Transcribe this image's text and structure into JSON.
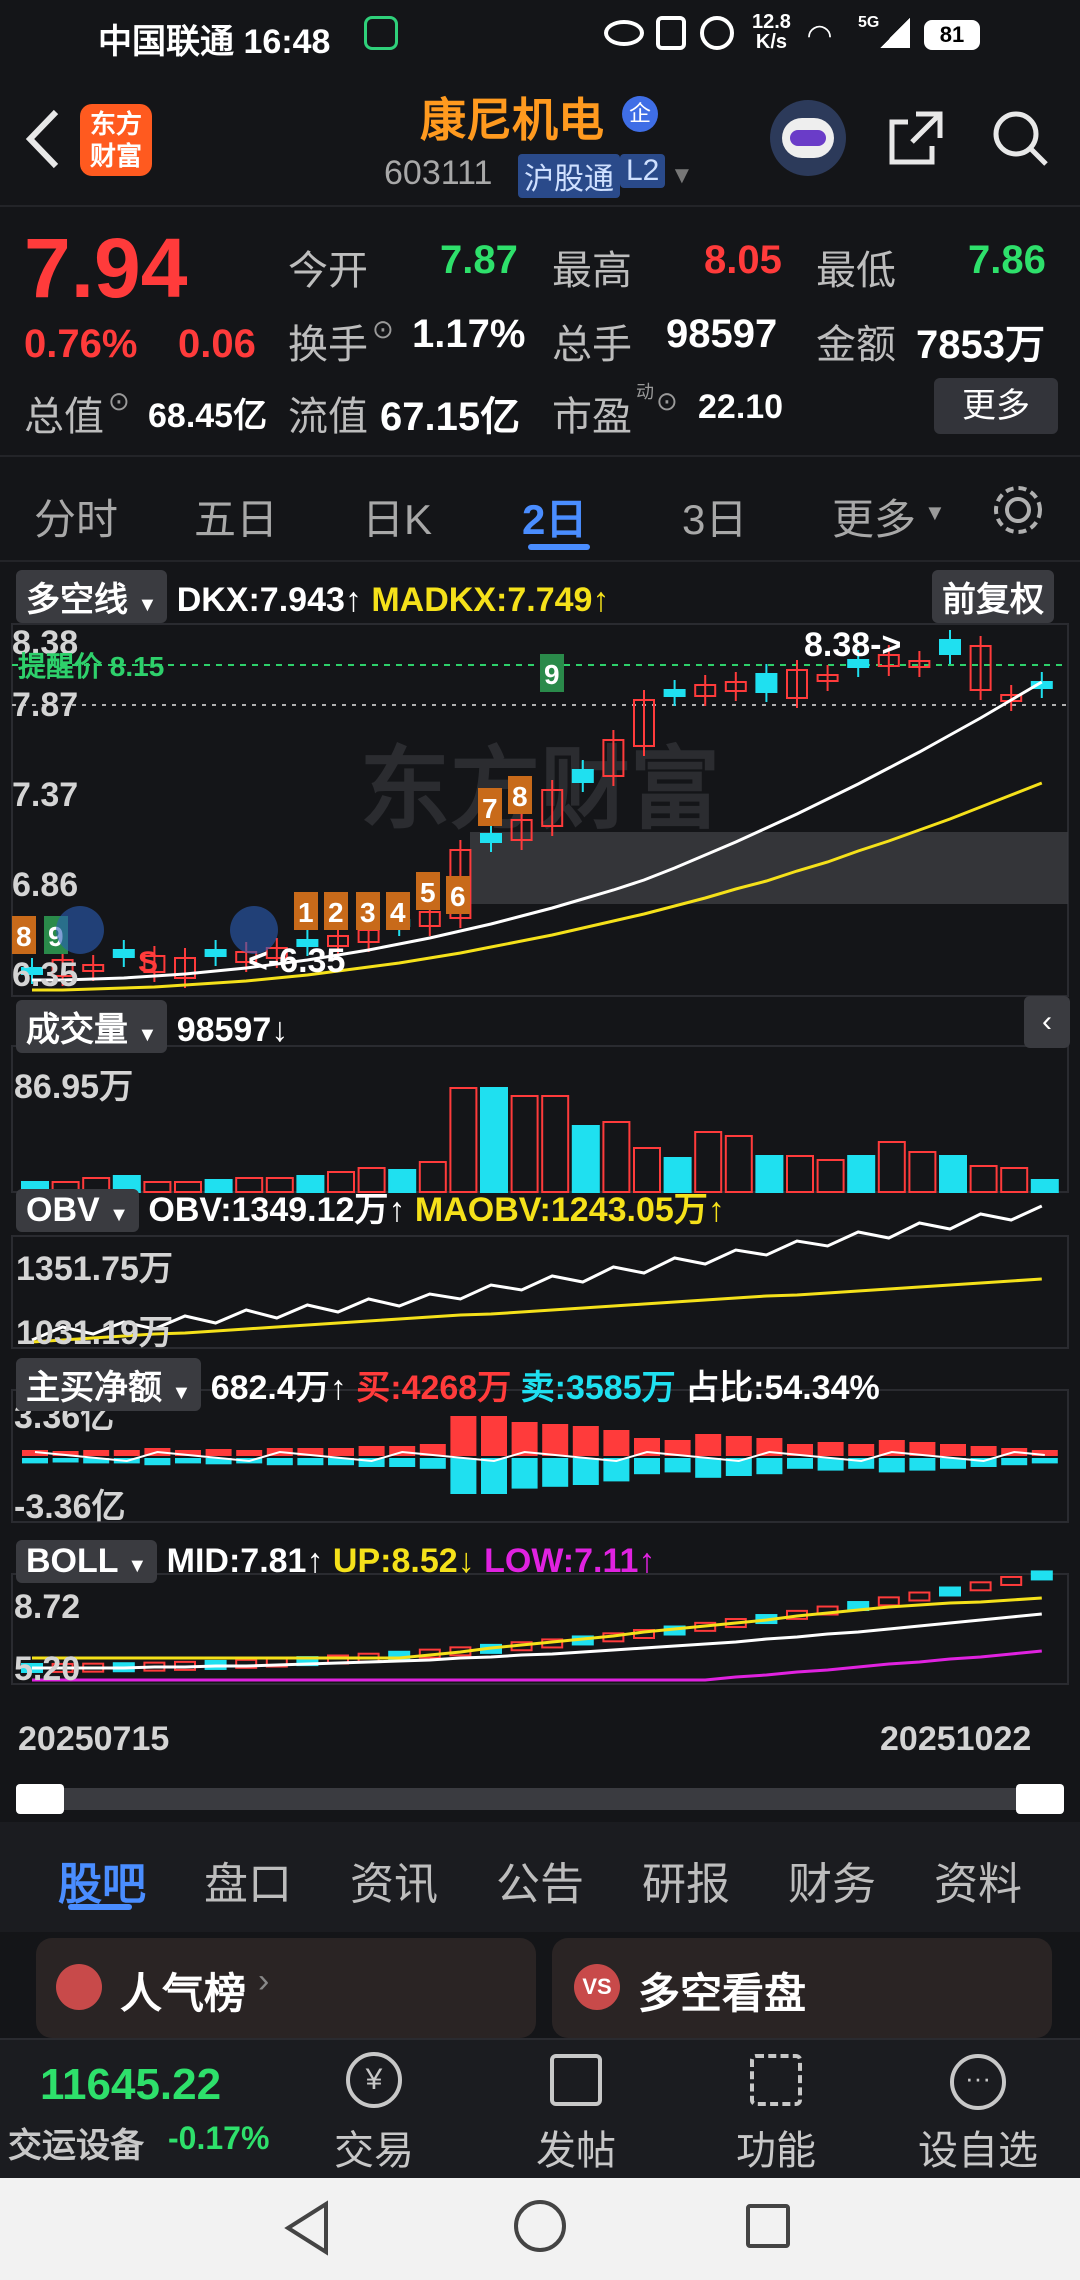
{
  "status_bar": {
    "carrier_time": "中国联通 16:48",
    "net_speed_top": "12.8",
    "net_speed_bottom": "K/s",
    "signal_5g": "5G",
    "battery": "81"
  },
  "header": {
    "logo_line1": "东方",
    "logo_line2": "财富",
    "stock_name": "康尼机电",
    "badge_qi": "企",
    "stock_code": "603111",
    "market_tag": "沪股通",
    "level_tag": "L2"
  },
  "quote": {
    "price": "7.94",
    "change_pct": "0.76%",
    "change_amt": "0.06",
    "open_label": "今开",
    "open": "7.87",
    "high_label": "最高",
    "high": "8.05",
    "low_label": "最低",
    "low": "7.86",
    "turnover_label": "换手",
    "turnover": "1.17%",
    "volume_label": "总手",
    "volume": "98597",
    "amount_label": "金额",
    "amount": "7853万",
    "mcap_label": "总值",
    "mcap": "68.45亿",
    "float_label": "流值",
    "float": "67.15亿",
    "pe_label": "市盈",
    "pe_sup": "动",
    "pe": "22.10",
    "more_button": "更多"
  },
  "chart_tabs": [
    "分时",
    "五日",
    "日K",
    "2日",
    "3日",
    "更多"
  ],
  "active_tab": "2日",
  "main_chart": {
    "indicator": "多空线",
    "dkx": "DKX:7.943↑",
    "madkx": "MADKX:7.749↑",
    "adjust": "前复权",
    "y_labels": [
      "8.38",
      "7.87",
      "7.37",
      "6.86",
      "6.35"
    ],
    "alert": "提醒价 8.15",
    "high_mark": "8.38->",
    "low_mark": "<-6.35",
    "s_mark": "S",
    "watermark": "东方财富",
    "seq_nums": [
      "8",
      "9",
      "1",
      "2",
      "3",
      "4",
      "5",
      "6",
      "7",
      "8",
      "9"
    ]
  },
  "volume_panel": {
    "label": "成交量",
    "value": "98597↓",
    "y_label": "86.95万"
  },
  "obv_panel": {
    "label": "OBV",
    "obv": "OBV:1349.12万↑",
    "maobv": "MAOBV:1243.05万↑",
    "y_top": "1351.75万",
    "y_bottom": "1031.19万"
  },
  "flow_panel": {
    "label": "主买净额",
    "net": "682.4万↑",
    "buy": "买:4268万",
    "sell": "卖:3585万",
    "ratio": "占比:54.34%",
    "y_top": "3.36亿",
    "y_bottom": "-3.36亿"
  },
  "boll_panel": {
    "label": "BOLL",
    "mid": "MID:7.81↑",
    "up": "UP:8.52↓",
    "low": "LOW:7.11↑",
    "y_top": "8.72",
    "y_bottom": "5.20"
  },
  "date_range": {
    "start": "20250715",
    "end": "20251022"
  },
  "bottom_tabs": [
    "股吧",
    "盘口",
    "资讯",
    "公告",
    "研报",
    "财务",
    "资料"
  ],
  "active_bottom_tab": "股吧",
  "cards": {
    "popular": "人气榜",
    "vs": "多空看盘"
  },
  "footer": {
    "index_value": "11645.22",
    "index_name": "交运设备",
    "index_change": "-0.17%",
    "nav": [
      "交易",
      "发帖",
      "功能",
      "设自选"
    ]
  },
  "colors": {
    "up": "#ff3b3b",
    "down": "#1fe0f0",
    "bg": "#141518",
    "accent": "#3f8cff",
    "yellow": "#f5e11a",
    "magenta": "#e022e0"
  }
}
